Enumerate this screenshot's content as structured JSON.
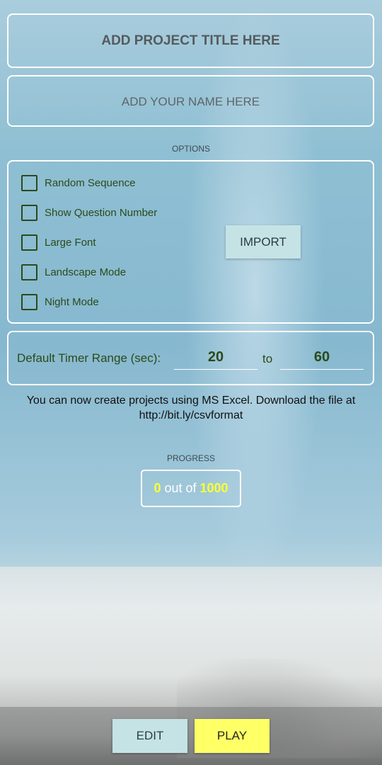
{
  "project_title_placeholder": "ADD PROJECT TITLE HERE",
  "name_placeholder": "ADD YOUR NAME HERE",
  "options": {
    "heading": "OPTIONS",
    "items": [
      {
        "label": "Random Sequence",
        "checked": false
      },
      {
        "label": "Show Question Number",
        "checked": false
      },
      {
        "label": "Large Font",
        "checked": false
      },
      {
        "label": "Landscape Mode",
        "checked": false
      },
      {
        "label": "Night Mode",
        "checked": false
      }
    ],
    "import_label": "IMPORT"
  },
  "timer": {
    "label": "Default Timer Range (sec):",
    "min": "20",
    "to": "to",
    "max": "60"
  },
  "info_line1": "You can now create projects using MS Excel. Download the file at",
  "info_line2": "http://bit.ly/csvformat",
  "progress": {
    "heading": "PROGRESS",
    "current": "0",
    "middle": "out of",
    "total": "1000"
  },
  "buttons": {
    "edit": "EDIT",
    "play": "PLAY"
  },
  "colors": {
    "accent_text": "#2b4a1a",
    "progress_number": "#ffff33",
    "play_button": "#ffff66",
    "secondary_button": "#c5e3e5"
  }
}
